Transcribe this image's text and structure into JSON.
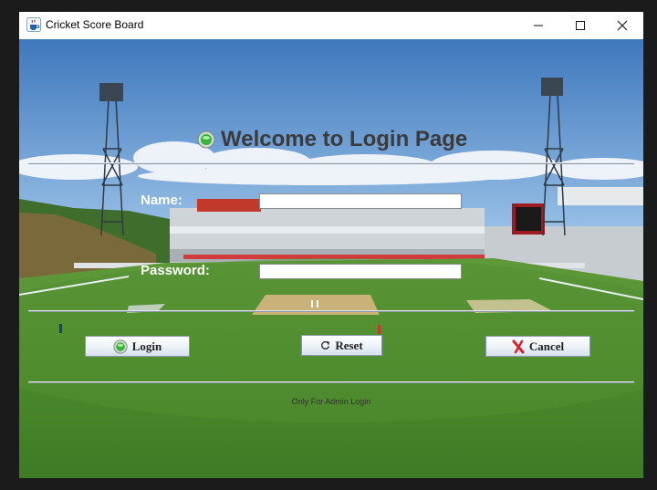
{
  "window": {
    "title": "Cricket Score Board",
    "title_icon": "java-cup-icon"
  },
  "controls": {
    "minimize": "minimize-icon",
    "maximize": "maximize-icon",
    "close": "close-icon"
  },
  "page": {
    "heading": "Welcome to Login Page",
    "heading_icon": "green-orb-icon"
  },
  "form": {
    "name_label": "Name:",
    "name_value": "",
    "password_label": "Password:",
    "password_value": ""
  },
  "buttons": {
    "login": {
      "label": "Login",
      "icon": "green-orb-icon"
    },
    "reset": {
      "label": "Reset",
      "icon": "refresh-icon"
    },
    "cancel": {
      "label": "Cancel",
      "icon": "red-x-icon"
    }
  },
  "footer": {
    "note": "Only For Admin Login"
  },
  "colors": {
    "sky": "#4a86c8",
    "grass": "#4c8a2c",
    "pitch": "#c9b27a",
    "heading": "#3b3b3b"
  }
}
